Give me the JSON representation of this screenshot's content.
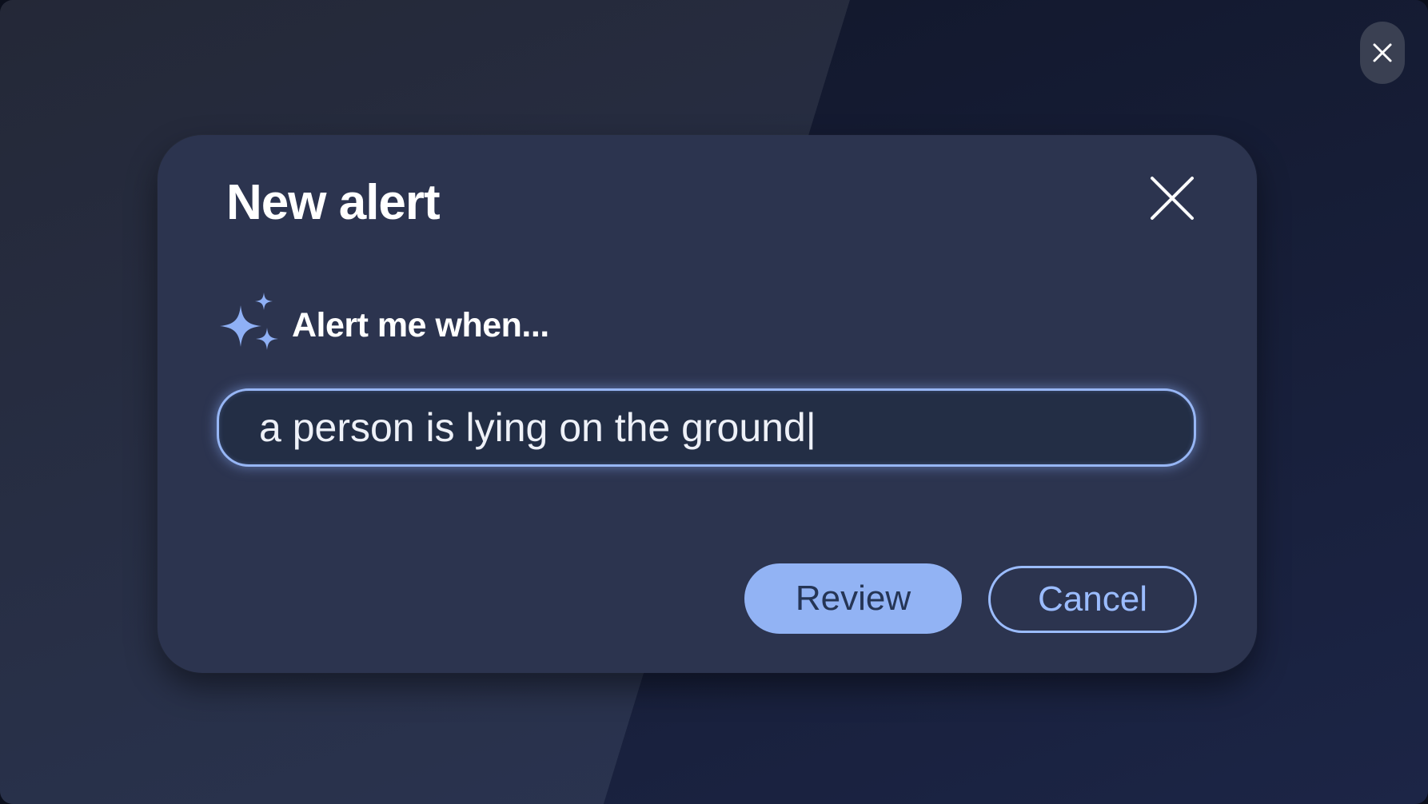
{
  "dialog": {
    "title": "New alert",
    "prompt_label": "Alert me when...",
    "input_value": "a person is lying on the ground|",
    "review_label": "Review",
    "cancel_label": "Cancel"
  },
  "icons": {
    "overlay_close": "close-icon",
    "dialog_close": "close-icon",
    "prompt": "sparkle-icon"
  },
  "colors": {
    "dialog_background": "#2c344f",
    "accent": "#92b3f4",
    "input_border": "#97b6f5",
    "review_text": "#253555",
    "cancel_text": "#9bbcff",
    "title_text": "#ffffff"
  }
}
